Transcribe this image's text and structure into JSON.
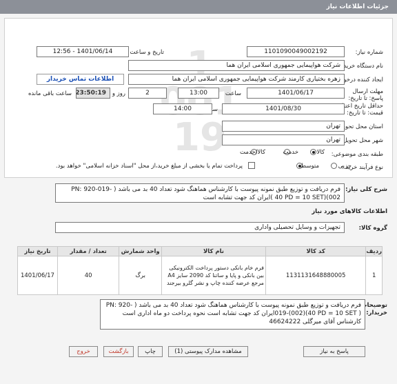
{
  "header": {
    "title": "جزئیات اطلاعات نیاز"
  },
  "form": {
    "need_number_label": "شماره نیاز:",
    "need_number": "1101090049002192",
    "announce_label": "تاریخ و ساعت اعلان عمومی:",
    "announce_value": "1401/06/14 - 12:56",
    "buyer_label": "نام دستگاه خریدار:",
    "buyer_value": "شرکت هواپیمایی جمهوری اسلامی ایران هما",
    "creator_label": "ایجاد کننده درخواست:",
    "creator_value": "زهره بختیاری کارمند شرکت هواپیمایی جمهوری اسلامی ایران هما",
    "contact_link": "اطلاعات تماس خریدار",
    "deadline_label": "مهلت ارسال پاسخ: تا تاریخ:",
    "deadline_date": "1401/06/17",
    "time_label": "ساعت",
    "deadline_time": "13:00",
    "day_label": "روز و",
    "days": "2",
    "remaining_time": "23:50:19",
    "remaining_label": "ساعت باقی مانده",
    "validity_label": "حداقل تاریخ اعتبار قیمت: تا تاریخ:",
    "validity_date": "1401/08/30",
    "validity_time_label": "ساعت",
    "validity_time": "14:00",
    "province_label": "استان محل تحویل:",
    "province_value": "تهران",
    "city_label": "شهر محل تحویل:",
    "city_value": "تهران",
    "category_label": "طبقه بندی موضوعی:",
    "category_options": [
      "کالا",
      "خدمت",
      "کالا/خدمت"
    ],
    "purchase_type_label": "نوع فرآیند خرید :",
    "purchase_options": [
      "جزیی",
      "متوسط"
    ],
    "payment_text": "پرداخت تمام یا بخشی از مبلغ خرید،از محل \"اسناد خزانه اسلامی\" خواهد بود."
  },
  "summary": {
    "label": "شرح کلی نیاز:",
    "text": "فرم دریافت و توزیع طبق نمونه پیوست  با کارشناس هماهنگ شود تعداد 40 بد می باشد  ( -019-920 :PN 002)(40 PD = 10 SET )ایران کد جهت تشابه است"
  },
  "goods_section": {
    "title": "اطلاعات کالاهای مورد نیاز"
  },
  "group": {
    "label": "گروه کالا:",
    "value": "تجهیزات و وسایل تحصیلی واداری"
  },
  "table": {
    "headers": [
      "ردیف",
      "کد کالا",
      "نام کالا",
      "واحد شمارش",
      "تعداد / مقدار",
      "تاریخ نیاز"
    ],
    "rows": [
      {
        "row": "1",
        "code": "1131131648880005",
        "name": "فرم خام بانکی دستور پرداخت الکترونیکی بین بانکی و پایا و ساتنا کد 2090 سایز A4 مرجع عرضه کننده چاپ و نشر گلرو بیرجند",
        "unit": "برگ",
        "qty": "40",
        "date": "1401/06/17"
      }
    ]
  },
  "buyer_notes": {
    "label": "توضیحات خریدار:",
    "text": "فرم دریافت و توزیع طبق نمونه پیوست  با کارشناس هماهنگ شود تعداد 40 بد می باشد  ( -PN: 920 019-(002)(40 PD = 10 SET )ایران کد جهت تشابه است نحوه پرداخت دو  ماه اداری است کارشناس آقای میرگلی  46624222"
  },
  "buttons": {
    "reply": "پاسخ به نیاز",
    "docs": "مشاهده مدارک پیوستی (1)",
    "print": "چاپ",
    "back": "بازگشت",
    "exit": "خروج"
  }
}
